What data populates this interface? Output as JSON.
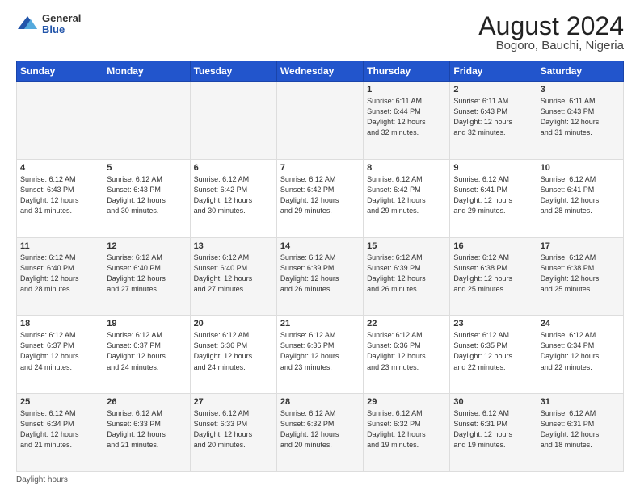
{
  "header": {
    "logo": {
      "general": "General",
      "blue": "Blue"
    },
    "title": "August 2024",
    "subtitle": "Bogoro, Bauchi, Nigeria"
  },
  "weekdays": [
    "Sunday",
    "Monday",
    "Tuesday",
    "Wednesday",
    "Thursday",
    "Friday",
    "Saturday"
  ],
  "weeks": [
    [
      {
        "day": "",
        "info": ""
      },
      {
        "day": "",
        "info": ""
      },
      {
        "day": "",
        "info": ""
      },
      {
        "day": "",
        "info": ""
      },
      {
        "day": "1",
        "info": "Sunrise: 6:11 AM\nSunset: 6:44 PM\nDaylight: 12 hours\nand 32 minutes."
      },
      {
        "day": "2",
        "info": "Sunrise: 6:11 AM\nSunset: 6:43 PM\nDaylight: 12 hours\nand 32 minutes."
      },
      {
        "day": "3",
        "info": "Sunrise: 6:11 AM\nSunset: 6:43 PM\nDaylight: 12 hours\nand 31 minutes."
      }
    ],
    [
      {
        "day": "4",
        "info": "Sunrise: 6:12 AM\nSunset: 6:43 PM\nDaylight: 12 hours\nand 31 minutes."
      },
      {
        "day": "5",
        "info": "Sunrise: 6:12 AM\nSunset: 6:43 PM\nDaylight: 12 hours\nand 30 minutes."
      },
      {
        "day": "6",
        "info": "Sunrise: 6:12 AM\nSunset: 6:42 PM\nDaylight: 12 hours\nand 30 minutes."
      },
      {
        "day": "7",
        "info": "Sunrise: 6:12 AM\nSunset: 6:42 PM\nDaylight: 12 hours\nand 29 minutes."
      },
      {
        "day": "8",
        "info": "Sunrise: 6:12 AM\nSunset: 6:42 PM\nDaylight: 12 hours\nand 29 minutes."
      },
      {
        "day": "9",
        "info": "Sunrise: 6:12 AM\nSunset: 6:41 PM\nDaylight: 12 hours\nand 29 minutes."
      },
      {
        "day": "10",
        "info": "Sunrise: 6:12 AM\nSunset: 6:41 PM\nDaylight: 12 hours\nand 28 minutes."
      }
    ],
    [
      {
        "day": "11",
        "info": "Sunrise: 6:12 AM\nSunset: 6:40 PM\nDaylight: 12 hours\nand 28 minutes."
      },
      {
        "day": "12",
        "info": "Sunrise: 6:12 AM\nSunset: 6:40 PM\nDaylight: 12 hours\nand 27 minutes."
      },
      {
        "day": "13",
        "info": "Sunrise: 6:12 AM\nSunset: 6:40 PM\nDaylight: 12 hours\nand 27 minutes."
      },
      {
        "day": "14",
        "info": "Sunrise: 6:12 AM\nSunset: 6:39 PM\nDaylight: 12 hours\nand 26 minutes."
      },
      {
        "day": "15",
        "info": "Sunrise: 6:12 AM\nSunset: 6:39 PM\nDaylight: 12 hours\nand 26 minutes."
      },
      {
        "day": "16",
        "info": "Sunrise: 6:12 AM\nSunset: 6:38 PM\nDaylight: 12 hours\nand 25 minutes."
      },
      {
        "day": "17",
        "info": "Sunrise: 6:12 AM\nSunset: 6:38 PM\nDaylight: 12 hours\nand 25 minutes."
      }
    ],
    [
      {
        "day": "18",
        "info": "Sunrise: 6:12 AM\nSunset: 6:37 PM\nDaylight: 12 hours\nand 24 minutes."
      },
      {
        "day": "19",
        "info": "Sunrise: 6:12 AM\nSunset: 6:37 PM\nDaylight: 12 hours\nand 24 minutes."
      },
      {
        "day": "20",
        "info": "Sunrise: 6:12 AM\nSunset: 6:36 PM\nDaylight: 12 hours\nand 24 minutes."
      },
      {
        "day": "21",
        "info": "Sunrise: 6:12 AM\nSunset: 6:36 PM\nDaylight: 12 hours\nand 23 minutes."
      },
      {
        "day": "22",
        "info": "Sunrise: 6:12 AM\nSunset: 6:36 PM\nDaylight: 12 hours\nand 23 minutes."
      },
      {
        "day": "23",
        "info": "Sunrise: 6:12 AM\nSunset: 6:35 PM\nDaylight: 12 hours\nand 22 minutes."
      },
      {
        "day": "24",
        "info": "Sunrise: 6:12 AM\nSunset: 6:34 PM\nDaylight: 12 hours\nand 22 minutes."
      }
    ],
    [
      {
        "day": "25",
        "info": "Sunrise: 6:12 AM\nSunset: 6:34 PM\nDaylight: 12 hours\nand 21 minutes."
      },
      {
        "day": "26",
        "info": "Sunrise: 6:12 AM\nSunset: 6:33 PM\nDaylight: 12 hours\nand 21 minutes."
      },
      {
        "day": "27",
        "info": "Sunrise: 6:12 AM\nSunset: 6:33 PM\nDaylight: 12 hours\nand 20 minutes."
      },
      {
        "day": "28",
        "info": "Sunrise: 6:12 AM\nSunset: 6:32 PM\nDaylight: 12 hours\nand 20 minutes."
      },
      {
        "day": "29",
        "info": "Sunrise: 6:12 AM\nSunset: 6:32 PM\nDaylight: 12 hours\nand 19 minutes."
      },
      {
        "day": "30",
        "info": "Sunrise: 6:12 AM\nSunset: 6:31 PM\nDaylight: 12 hours\nand 19 minutes."
      },
      {
        "day": "31",
        "info": "Sunrise: 6:12 AM\nSunset: 6:31 PM\nDaylight: 12 hours\nand 18 minutes."
      }
    ]
  ],
  "footer": "Daylight hours"
}
